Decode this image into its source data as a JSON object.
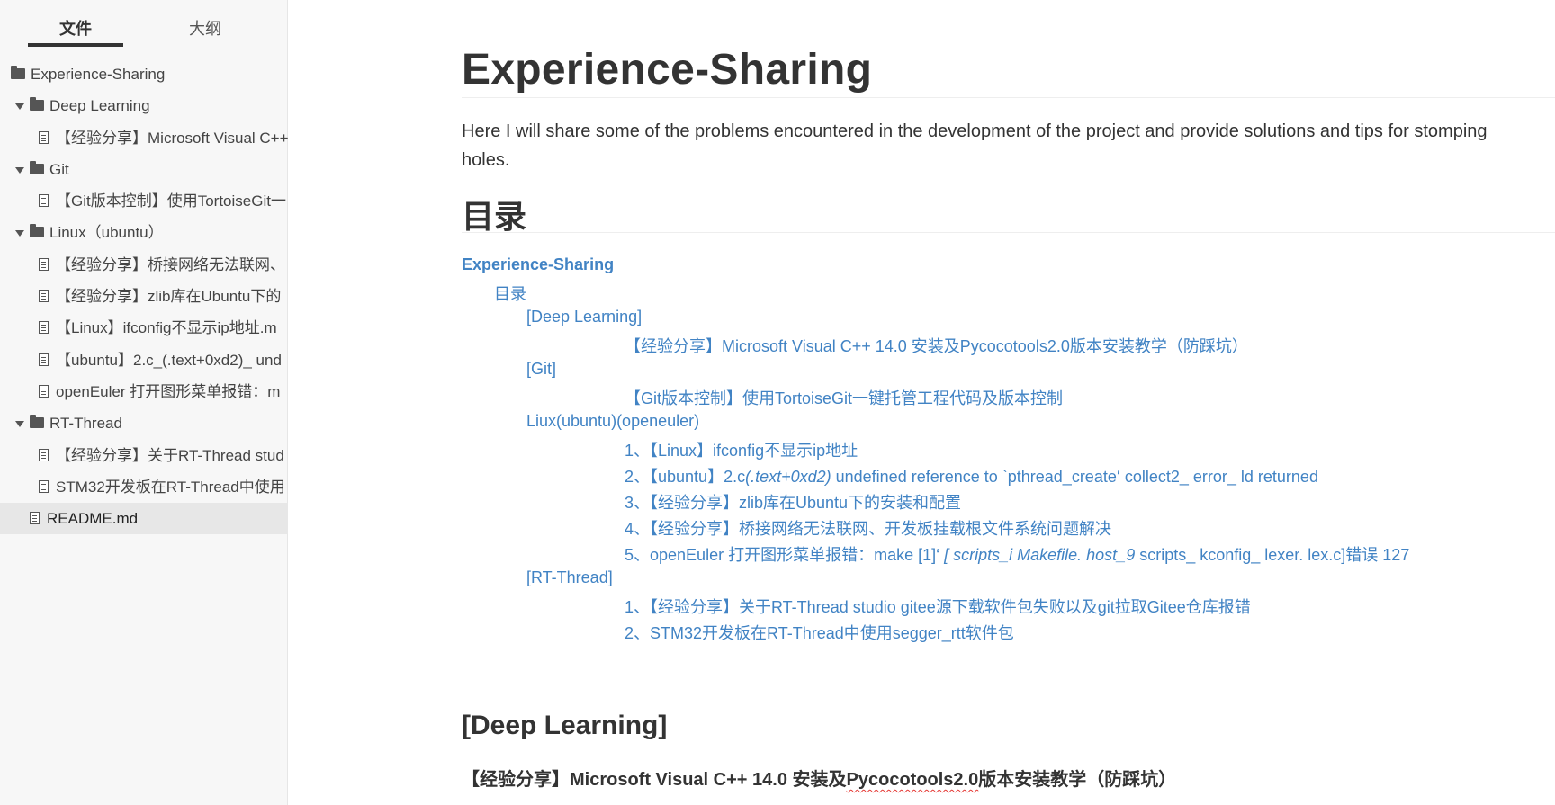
{
  "sidebar": {
    "tabs": {
      "files": "文件",
      "outline": "大纲"
    },
    "tree": [
      {
        "type": "folder",
        "label": "Experience-Sharing",
        "level": 0,
        "expanded": false
      },
      {
        "type": "folder",
        "label": "Deep Learning",
        "level": 1,
        "expanded": true
      },
      {
        "type": "file",
        "label": "【经验分享】Microsoft Visual C++",
        "level": 2
      },
      {
        "type": "folder",
        "label": "Git",
        "level": 1,
        "expanded": true
      },
      {
        "type": "file",
        "label": "【Git版本控制】使用TortoiseGit一",
        "level": 2
      },
      {
        "type": "folder",
        "label": "Linux（ubuntu）",
        "level": 1,
        "expanded": true
      },
      {
        "type": "file",
        "label": "【经验分享】桥接网络无法联网、",
        "level": 2
      },
      {
        "type": "file",
        "label": "【经验分享】zlib库在Ubuntu下的",
        "level": 2
      },
      {
        "type": "file",
        "label": "【Linux】ifconfig不显示ip地址.m",
        "level": 2
      },
      {
        "type": "file",
        "label": "【ubuntu】2.c_(.text+0xd2)_ und",
        "level": 2
      },
      {
        "type": "file",
        "label": "openEuler 打开图形菜单报错：m",
        "level": 2
      },
      {
        "type": "folder",
        "label": "RT-Thread",
        "level": 1,
        "expanded": true
      },
      {
        "type": "file",
        "label": "【经验分享】关于RT-Thread stud",
        "level": 2
      },
      {
        "type": "file",
        "label": "STM32开发板在RT-Thread中使用",
        "level": 2
      },
      {
        "type": "file",
        "label": "README.md",
        "level": 1,
        "active": true
      }
    ]
  },
  "main": {
    "title": "Experience-Sharing",
    "intro": "Here I will share some of the problems encountered in the development of the project and provide solutions and tips for stomping holes.",
    "toc_heading": "目录",
    "toc": {
      "root": "Experience-Sharing",
      "mulu": "目录",
      "dl_cat": "[Deep Learning]",
      "dl_1": "【经验分享】Microsoft Visual C++ 14.0 安装及Pycocotools2.0版本安装教学（防踩坑）",
      "git_cat": "[Git]",
      "git_1": "【Git版本控制】使用TortoiseGit一键托管工程代码及版本控制",
      "linux_cat": "Liux(ubuntu)(openeuler)",
      "linux_1": "1、【Linux】ifconfig不显示ip地址",
      "linux_2_a": "2、【ubuntu】2.c",
      "linux_2_b": "(.text+0xd2)",
      "linux_2_c": " undefined reference to `pthread_create‘ collect2_ error_ ld returned",
      "linux_3": "3、【经验分享】zlib库在Ubuntu下的安装和配置",
      "linux_4": "4、【经验分享】桥接网络无法联网、开发板挂载根文件系统问题解决",
      "linux_5_a": "5、openEuler 打开图形菜单报错：make [1]‘",
      "linux_5_b": " [ scripts_i Makefile. host_9",
      "linux_5_c": " scripts_ kconfig_ lexer. lex.c]错误 127",
      "rt_cat": "[RT-Thread]",
      "rt_1": "1、【经验分享】关于RT-Thread studio gitee源下载软件包失败以及git拉取Gitee仓库报错",
      "rt_2": "2、STM32开发板在RT-Thread中使用segger_rtt软件包"
    },
    "section_deep_learning": "[Deep Learning]",
    "subheading_a": "【经验分享】Microsoft Visual C++ 14.0 安装及",
    "subheading_b": "Pycocotools2.0",
    "subheading_c": "版本安装教学（防踩坑）"
  },
  "colors": {
    "link": "#4183c4",
    "text": "#333333",
    "sidebar_bg": "#f7f7f7",
    "active_row": "#e7e7e7"
  },
  "icons": {
    "folder": "folder-icon",
    "file": "document-icon",
    "expand": "caret-down-icon"
  }
}
